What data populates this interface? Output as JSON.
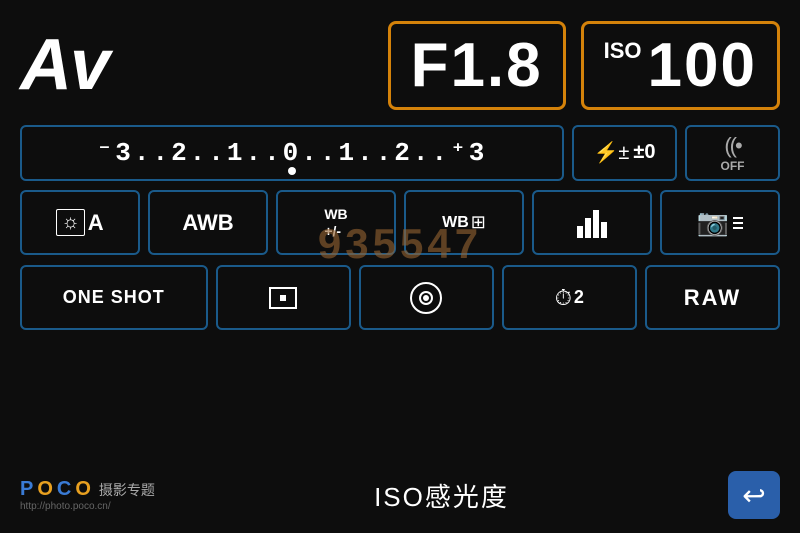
{
  "header": {
    "mode_label": "Av",
    "aperture_value": "F1.8",
    "iso_prefix": "ISO",
    "iso_value": "100"
  },
  "exposure": {
    "scale": "⁻3..2..1..0..1..2..⁺3",
    "scale_display": "¯3..2..1..0̲..1..2..⁺3",
    "flash_comp": "±0",
    "wifi_status": "OFF"
  },
  "row3": {
    "scene": "☀A",
    "wb": "AWB",
    "wb_adj": "WB+/-",
    "wb_shift": "WB",
    "picture_style": "📊",
    "lens_correction": "📷"
  },
  "row4": {
    "focus_mode": "ONE SHOT",
    "metering": "⊡",
    "live_view": "⊙",
    "drive": "🔔2",
    "quality": "RAW"
  },
  "bottom": {
    "brand_p": "P",
    "brand_o1": "O",
    "brand_c": "C",
    "brand_o2": "O",
    "brand_sub": "摄影专题",
    "url": "http://photo.poco.cn/",
    "iso_label": "ISO感光度",
    "back_icon": "↩"
  },
  "watermark": "935547"
}
